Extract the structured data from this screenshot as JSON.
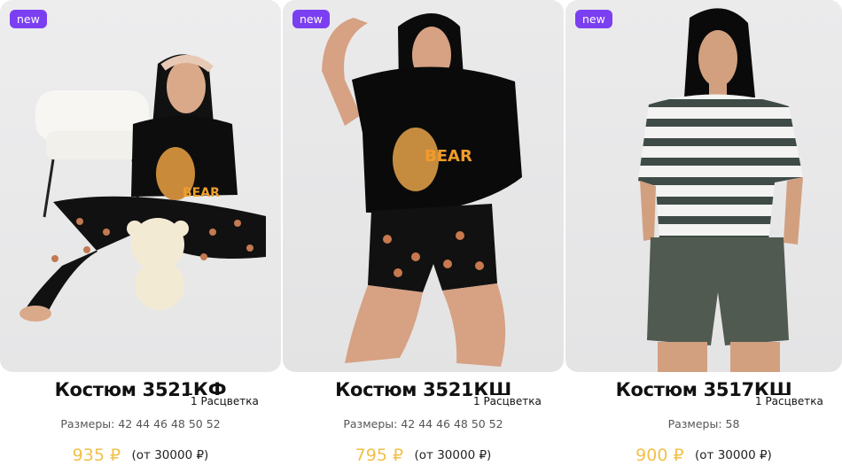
{
  "products": [
    {
      "badge": "new",
      "title": "Костюм 3521КФ",
      "colors": "1 Расцветка",
      "sizes": "Размеры: 42 44 46 48 50 52",
      "price": "935 ₽",
      "wholesale": "(от 30000 ₽)",
      "photo_alt": "Model in black bear print t-shirt and trousers with teddy bear"
    },
    {
      "badge": "new",
      "title": "Костюм 3521КШ",
      "colors": "1 Расцветка",
      "sizes": "Размеры: 42 44 46 48 50 52",
      "price": "795 ₽",
      "wholesale": "(от 30000 ₽)",
      "photo_alt": "Model kneeling in black bear print t-shirt and shorts"
    },
    {
      "badge": "new",
      "title": "Костюм 3517КШ",
      "colors": "1 Расцветка",
      "sizes": "Размеры: 58",
      "price": "900 ₽",
      "wholesale": "(от 30000 ₽)",
      "photo_alt": "Model in striped t-shirt and khaki shorts"
    }
  ],
  "colors": {
    "badge": "#7b3ff2",
    "price": "#f2c04a"
  }
}
